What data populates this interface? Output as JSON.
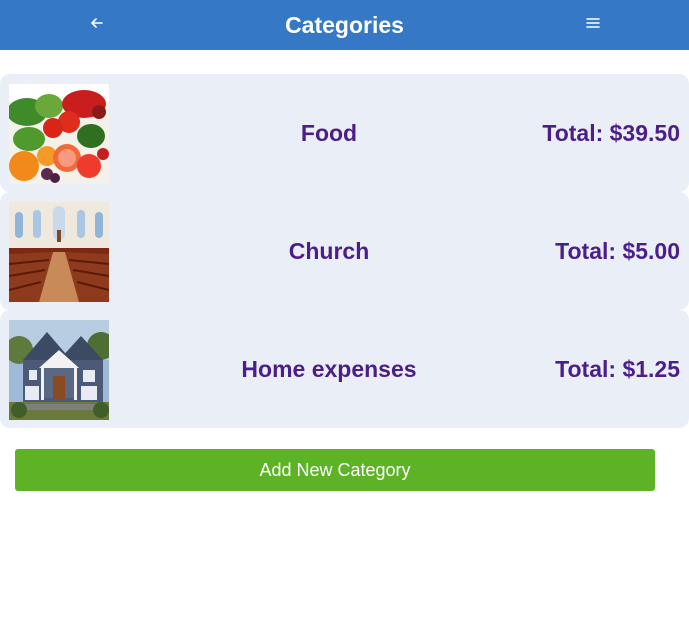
{
  "header": {
    "title": "Categories",
    "back_icon": "arrow-left-icon",
    "menu_icon": "hamburger-menu-icon"
  },
  "categories": [
    {
      "name": "Food",
      "total": "Total: $39.50",
      "image": "vegetables-photo"
    },
    {
      "name": "Church",
      "total": "Total: $5.00",
      "image": "church-interior-photo"
    },
    {
      "name": "Home expenses",
      "total": "Total: $1.25",
      "image": "house-photo"
    }
  ],
  "add_button": {
    "label": "Add New Category"
  },
  "colors": {
    "header_bg": "#3578c6",
    "row_bg": "#eaeff7",
    "text_accent": "#4b1e8a",
    "button_bg": "#5db325"
  }
}
